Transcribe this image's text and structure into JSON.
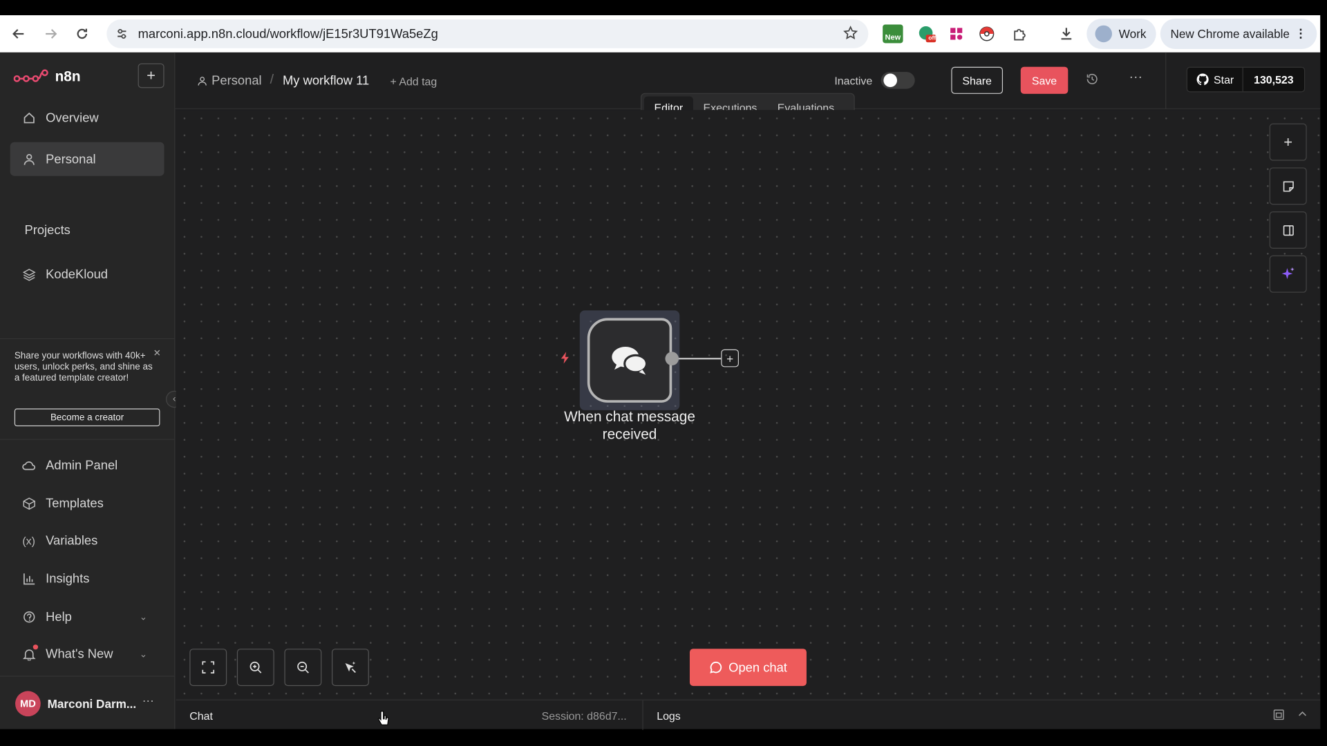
{
  "browser": {
    "url": "marconi.app.n8n.cloud/workflow/jE15r3UT91Wa5eZg",
    "profile": "Work",
    "update_label": "New Chrome available",
    "ext_new_badge": "New",
    "ext_off_badge": "off"
  },
  "sidebar": {
    "brand": "n8n",
    "nav": [
      {
        "label": "Overview",
        "icon": "home-icon"
      },
      {
        "label": "Personal",
        "icon": "user-icon"
      }
    ],
    "projects_title": "Projects",
    "projects": [
      {
        "label": "KodeKloud",
        "icon": "layers-icon"
      }
    ],
    "promo": {
      "text": "Share your workflows with 40k+ users, unlock perks, and shine as a featured template creator!",
      "button": "Become a creator"
    },
    "bottom_nav": [
      {
        "label": "Admin Panel",
        "icon": "cloud-icon"
      },
      {
        "label": "Templates",
        "icon": "box-icon"
      },
      {
        "label": "Variables",
        "icon": "variable-icon"
      },
      {
        "label": "Insights",
        "icon": "chart-icon"
      },
      {
        "label": "Help",
        "icon": "help-icon"
      },
      {
        "label": "What's New",
        "icon": "bell-icon"
      }
    ],
    "user": {
      "initials": "MD",
      "name": "Marconi Darm..."
    }
  },
  "header": {
    "breadcrumb_project": "Personal",
    "workflow_name": "My workflow 11",
    "add_tag": "+ Add tag",
    "active_label": "Inactive",
    "active": false,
    "share_label": "Share",
    "save_label": "Save",
    "github_star": "Star",
    "github_count": "130,523"
  },
  "tabs": [
    {
      "label": "Editor",
      "active": true
    },
    {
      "label": "Executions",
      "active": false
    },
    {
      "label": "Evaluations",
      "active": false
    }
  ],
  "canvas": {
    "node_label": "When chat message received",
    "open_chat_label": "Open chat"
  },
  "bottom": {
    "chat_label": "Chat",
    "session": "Session: d86d7...",
    "logs_label": "Logs"
  },
  "colors": {
    "accent": "#e8535d",
    "canvas_bg": "#1f1f20",
    "sidebar_bg": "#262626"
  }
}
